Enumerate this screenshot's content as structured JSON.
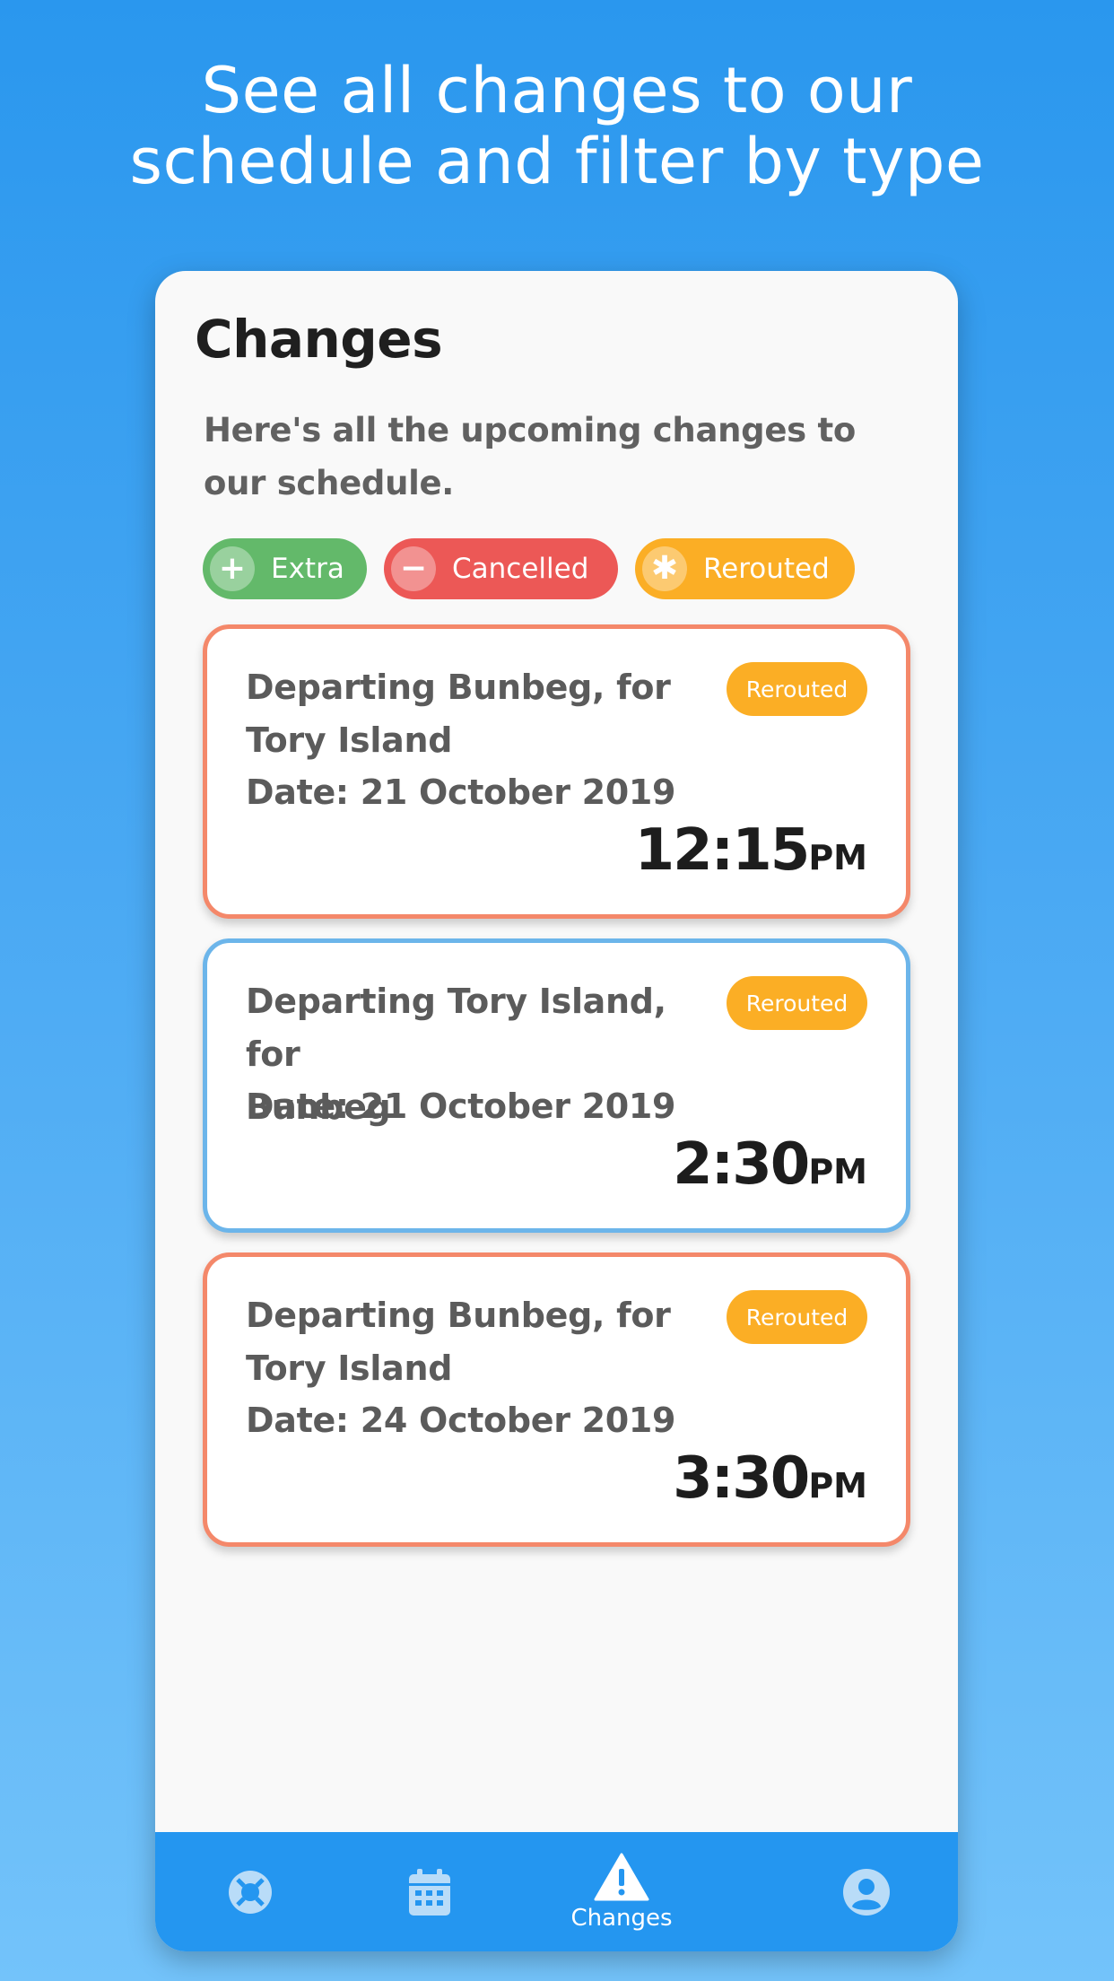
{
  "headline": {
    "line1": "See all changes to our",
    "line2": "schedule and filter by type"
  },
  "screen": {
    "title": "Changes",
    "intro": "Here's all the upcoming changes to our schedule."
  },
  "filters": [
    {
      "label": "Extra",
      "symbol": "+",
      "color": "#63b96a"
    },
    {
      "label": "Cancelled",
      "symbol": "−",
      "color": "#ec5856"
    },
    {
      "label": "Rerouted",
      "symbol": "✱",
      "color": "#fbae25"
    }
  ],
  "changes": [
    {
      "route_line1": "Departing Bunbeg, for",
      "route_line2": "Tory Island",
      "date": "Date: 21 October 2019",
      "badge": "Rerouted",
      "time": "12:15",
      "ampm": "PM",
      "border_color": "#f4886a"
    },
    {
      "route_line1": "Departing Tory Island, for",
      "route_line2": "Bunbeg",
      "date": "Date: 21 October 2019",
      "badge": "Rerouted",
      "time": "2:30",
      "ampm": "PM",
      "border_color": "#6cb5ea"
    },
    {
      "route_line1": "Departing Bunbeg, for",
      "route_line2": "Tory Island",
      "date": "Date: 24 October 2019",
      "badge": "Rerouted",
      "time": "3:30",
      "ampm": "PM",
      "border_color": "#f4886a"
    }
  ],
  "tabbar": {
    "tabs": [
      {
        "icon": "lifebuoy-icon",
        "label": ""
      },
      {
        "icon": "calendar-icon",
        "label": ""
      },
      {
        "icon": "warning-icon",
        "label": "Changes",
        "active": true
      },
      {
        "icon": "user-icon",
        "label": ""
      }
    ],
    "background": "#2496f0"
  }
}
